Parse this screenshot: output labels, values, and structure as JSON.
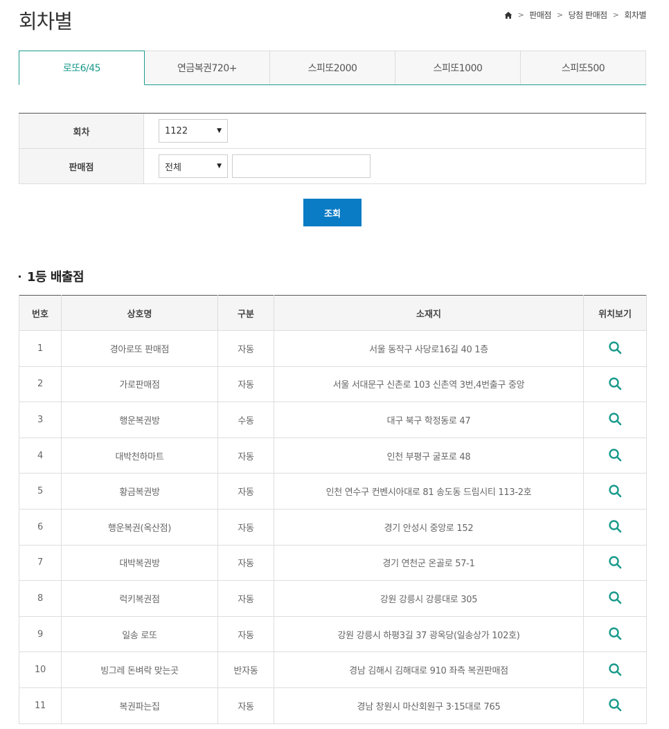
{
  "page": {
    "title": "회차별",
    "breadcrumb": [
      "판매점",
      "당첨 판매점",
      "회차별"
    ]
  },
  "tabs": [
    {
      "label": "로또6/45",
      "active": true
    },
    {
      "label": "연금복권720+",
      "active": false
    },
    {
      "label": "스피또2000",
      "active": false
    },
    {
      "label": "스피또1000",
      "active": false
    },
    {
      "label": "스피또500",
      "active": false
    }
  ],
  "search": {
    "round_label": "회차",
    "round_value": "1122",
    "store_label": "판매점",
    "store_filter_value": "전체",
    "store_input_value": "",
    "submit_label": "조회"
  },
  "results": {
    "section_title": "1등 배출점",
    "headers": [
      "번호",
      "상호명",
      "구분",
      "소재지",
      "위치보기"
    ],
    "rows": [
      {
        "no": "1",
        "name": "경아로또 판매점",
        "type": "자동",
        "address": "서울 동작구 사당로16길 40 1층"
      },
      {
        "no": "2",
        "name": "가로판매점",
        "type": "자동",
        "address": "서울 서대문구 신촌로 103 신촌역 3번,4번출구 중앙"
      },
      {
        "no": "3",
        "name": "행운복권방",
        "type": "수동",
        "address": "대구 북구 학정동로 47"
      },
      {
        "no": "4",
        "name": "대박천하마트",
        "type": "자동",
        "address": "인천 부평구 굴포로 48"
      },
      {
        "no": "5",
        "name": "황금복권방",
        "type": "자동",
        "address": "인천 연수구 컨벤시아대로 81 송도동 드림시티 113-2호"
      },
      {
        "no": "6",
        "name": "행운복권(옥산점)",
        "type": "자동",
        "address": "경기 안성시 중앙로 152"
      },
      {
        "no": "7",
        "name": "대박복권방",
        "type": "자동",
        "address": "경기 연천군 온골로 57-1"
      },
      {
        "no": "8",
        "name": "럭키복권점",
        "type": "자동",
        "address": "강원 강릉시 강릉대로 305"
      },
      {
        "no": "9",
        "name": "일송 로또",
        "type": "자동",
        "address": "강원 강릉시 하평3길 37 광옥당(일송상가 102호)"
      },
      {
        "no": "10",
        "name": "빙그레 돈벼락 맞는곳",
        "type": "반자동",
        "address": "경남 김해시 김해대로 910 좌측 복권판매점"
      },
      {
        "no": "11",
        "name": "복권파는집",
        "type": "자동",
        "address": "경남 창원시 마산회원구 3·15대로 765"
      }
    ]
  },
  "colors": {
    "accent": "#1a9a8c",
    "button": "#0a7bc5"
  },
  "icons": {
    "home": "home-icon",
    "map": "search-icon"
  }
}
